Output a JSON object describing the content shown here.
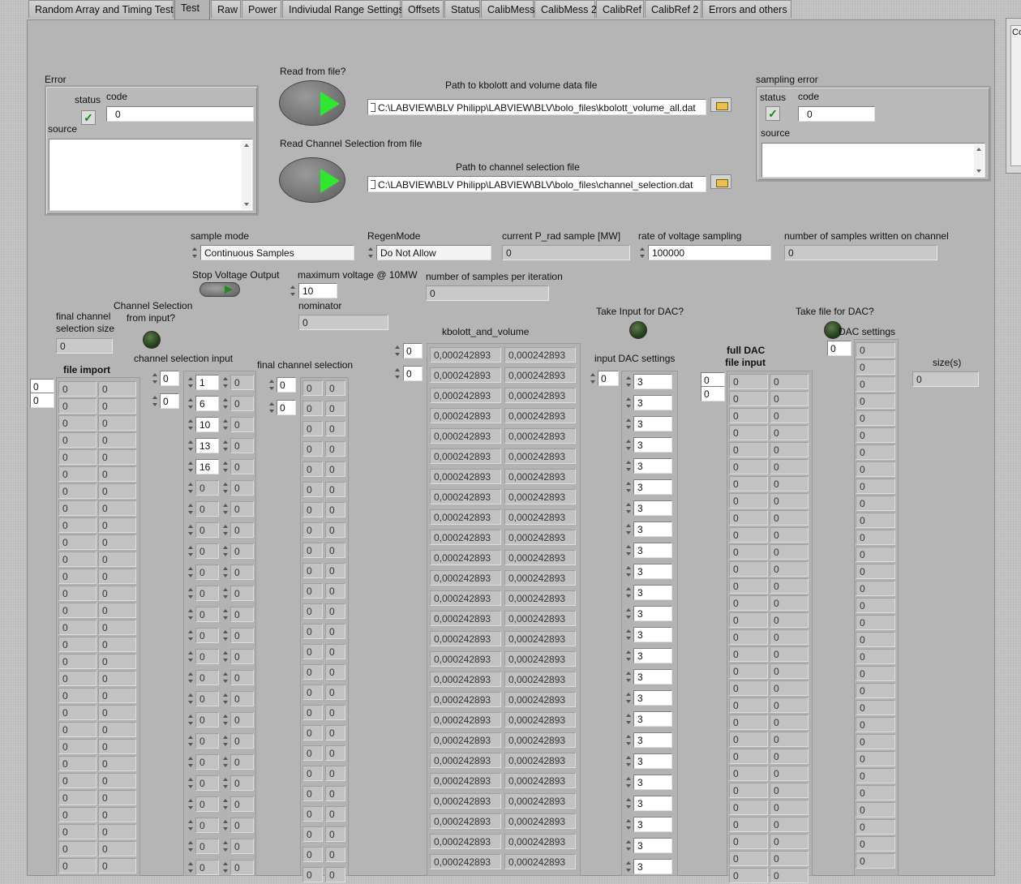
{
  "tabs": [
    "Random Array and Timing Test",
    "Test",
    "Raw",
    "Power",
    "Indiviudal Range Settings",
    "Offsets",
    "Status",
    "CalibMess",
    "CalibMess 2",
    "CalibRef",
    "CalibRef 2",
    "Errors and others"
  ],
  "active_tab": "Test",
  "side_window_label": "Co",
  "error_cluster": {
    "label": "Error",
    "status_label": "status",
    "code_label": "code",
    "code_value": "0",
    "source_label": "source",
    "status_mark": "✓"
  },
  "read_from_file": {
    "label": "Read from file?",
    "path_label": "Path to kbolott and volume data file",
    "path_value": "C:\\LABVIEW\\BLV Philipp\\LABVIEW\\BLV\\bolo_files\\kbolott_volume_all.dat"
  },
  "read_channel_selection": {
    "label": "Read Channel Selection from file",
    "path_label": "Path to channel selection file",
    "path_value": "C:\\LABVIEW\\BLV Philipp\\LABVIEW\\BLV\\bolo_files\\channel_selection.dat"
  },
  "sampling_error": {
    "label": "sampling error",
    "status_label": "status",
    "code_label": "code",
    "code_value": "0",
    "source_label": "source",
    "status_mark": "✓"
  },
  "controls": {
    "sample_mode_label": "sample mode",
    "sample_mode_value": "Continuous Samples",
    "regen_mode_label": "RegenMode",
    "regen_mode_value": "Do Not Allow",
    "current_prad_label": "current P_rad sample [MW]",
    "current_prad_value": "0",
    "rate_label": "rate of voltage sampling",
    "rate_value": "100000",
    "samples_written_label": "number of samples written on channel",
    "samples_written_value": "0",
    "stop_voltage_label": "Stop Voltage Output",
    "max_voltage_label": "maximum voltage @ 10MW",
    "max_voltage_value": "10",
    "nominator_label": "nominator",
    "nominator_value": "0",
    "samples_per_iter_label": "number of samples per iteration",
    "samples_per_iter_value": "0",
    "final_size_label_1": "final channel",
    "final_size_label_2": "selection size",
    "final_size_value": "0",
    "channel_sel_input_q_1": "Channel Selection",
    "channel_sel_input_q_2": "from input?",
    "take_input_dac_label": "Take Input for DAC?",
    "take_file_dac_label": "Take file for DAC?",
    "size_label": "size(s)",
    "size_value": "0"
  },
  "arrays": {
    "file_import_label": "file import",
    "channel_selection_input_label": "channel selection input",
    "final_channel_selection_label": "final channel selection",
    "kbolott_label": "kbolott_and_volume",
    "input_dac_label": "input DAC settings",
    "full_dac_label_1": "full DAC",
    "full_dac_label_2": "file input",
    "dac_settings_label": "DAC settings",
    "index_zero": "0",
    "zero": "0",
    "kbolott_value": "0,000242893",
    "dac_input_value": "3",
    "channel_selection_values": [
      "1",
      "6",
      "10",
      "13",
      "16"
    ]
  }
}
